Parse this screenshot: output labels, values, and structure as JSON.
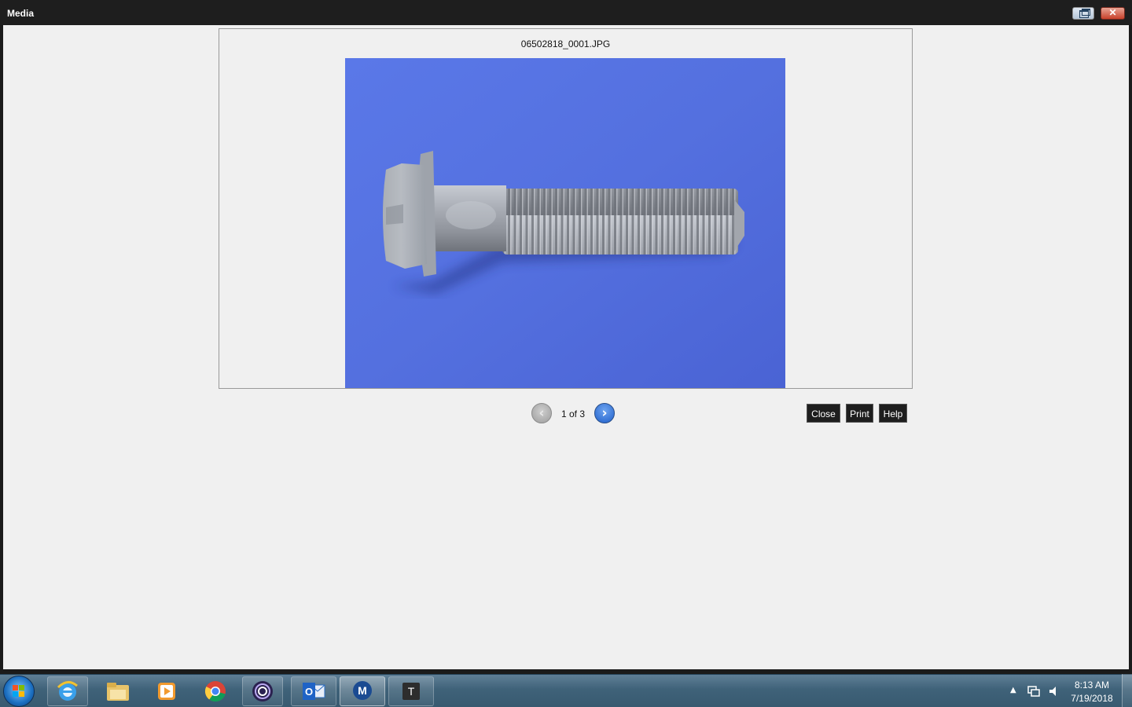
{
  "window": {
    "title": "Media",
    "restore_icon": "restore-icon",
    "close_icon": "close-icon",
    "close_glyph": "✕"
  },
  "viewer": {
    "filename": "06502818_0001.JPG",
    "photo_subject": "flange-head-hex-bolt-on-blue-background"
  },
  "navigation": {
    "prev_icon": "chevron-left-icon",
    "next_icon": "chevron-right-icon",
    "prev_glyph": "‹",
    "next_glyph": "›",
    "page_count": "1 of 3"
  },
  "actions": {
    "close_label": "Close",
    "print_label": "Print",
    "help_label": "Help"
  },
  "taskbar": {
    "start_icon": "windows-start-icon",
    "pinned": [
      {
        "name": "internet-explorer-icon"
      },
      {
        "name": "file-explorer-icon"
      },
      {
        "name": "media-player-icon"
      },
      {
        "name": "chrome-icon"
      },
      {
        "name": "app-swirl-icon"
      },
      {
        "name": "outlook-icon",
        "letter": "O"
      },
      {
        "name": "mopar-icon",
        "letter": "M"
      },
      {
        "name": "app-t-icon",
        "letter": "T"
      }
    ],
    "tray": {
      "show_hidden_glyph": "▲",
      "network_icon": "network-icon",
      "volume_icon": "volume-icon",
      "time": "8:13 AM",
      "date": "7/19/2018"
    }
  },
  "colors": {
    "photo_background": "#5570e0",
    "accent_blue": "#1f5fc9",
    "button_dark": "#1e1e1e"
  }
}
